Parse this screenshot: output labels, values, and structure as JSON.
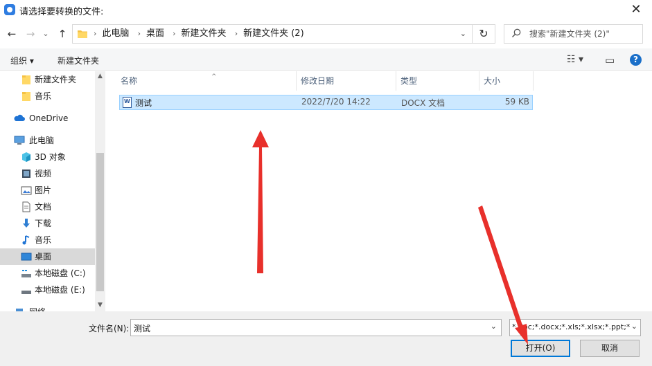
{
  "window": {
    "title": "请选择要转换的文件:"
  },
  "nav": {
    "back": "←",
    "forward": "→",
    "recent": "⌄",
    "up": "↑",
    "breadcrumb": [
      "此电脑",
      "桌面",
      "新建文件夹",
      "新建文件夹 (2)"
    ],
    "refresh": "↻",
    "search_placeholder": "搜索\"新建文件夹 (2)\""
  },
  "toolbar": {
    "organize": "组织 ▾",
    "new_folder": "新建文件夹",
    "view": "☷ ▾",
    "pane": "▭",
    "help": "?"
  },
  "sidebar": {
    "items": [
      {
        "label": "新建文件夹",
        "icon": "folder-icon"
      },
      {
        "label": "音乐",
        "icon": "folder-icon"
      },
      {
        "label": "OneDrive",
        "icon": "cloud-icon"
      },
      {
        "label": "此电脑",
        "icon": "computer-icon"
      },
      {
        "label": "3D 对象",
        "icon": "cube-icon"
      },
      {
        "label": "视频",
        "icon": "video-icon"
      },
      {
        "label": "图片",
        "icon": "picture-icon"
      },
      {
        "label": "文档",
        "icon": "document-icon"
      },
      {
        "label": "下载",
        "icon": "download-icon"
      },
      {
        "label": "音乐",
        "icon": "music-icon"
      },
      {
        "label": "桌面",
        "icon": "desktop-icon"
      },
      {
        "label": "本地磁盘 (C:)",
        "icon": "drive-icon"
      },
      {
        "label": "本地磁盘 (E:)",
        "icon": "drive-icon"
      },
      {
        "label": "网络",
        "icon": "network-icon"
      }
    ],
    "selected": "桌面"
  },
  "filelist": {
    "columns": [
      "名称",
      "修改日期",
      "类型",
      "大小"
    ],
    "rows": [
      {
        "name": "测试",
        "modified": "2022/7/20 14:22",
        "type": "DOCX 文档",
        "size": "59 KB"
      }
    ]
  },
  "bottom": {
    "filename_label": "文件名(N):",
    "filename_value": "测试",
    "filter_value": "*.doc;*.docx;*.xls;*.xlsx;*.ppt;*",
    "open_label": "打开(O)",
    "cancel_label": "取消"
  },
  "colors": {
    "accent": "#0078d7",
    "selection": "#cce8ff",
    "arrow": "#e8302b"
  }
}
